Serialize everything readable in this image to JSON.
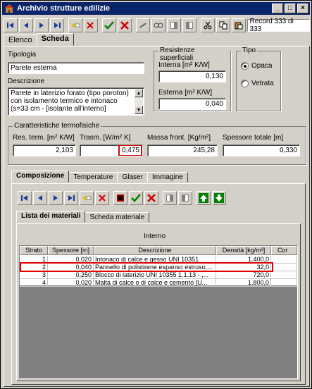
{
  "window": {
    "title": "Archivio strutture edilizie",
    "controls": [
      "_",
      "□",
      "×"
    ]
  },
  "toolbar": {
    "buttons": [
      "first",
      "prev",
      "next",
      "last",
      "insert",
      "delete",
      "confirm",
      "cancel",
      "tools",
      "search",
      "copy",
      "paste",
      "cut",
      "copy2",
      "print"
    ],
    "record": "Record 333 di 333"
  },
  "tabs": [
    "Elenco",
    "Scheda"
  ],
  "form": {
    "tipologia_label": "Tipologia",
    "tipologia_value": "Parete esterna",
    "descrizione_label": "Descrizione",
    "descrizione_value": "Parete in laterizio forato (tipo poroton) con isolamento termico e intonaco (s=33 cm - [isolante all'interno]"
  },
  "resistenze": {
    "title": "Resistenze superficiali",
    "interna_label": "Interna [m² K/W]",
    "interna_value": "0,130",
    "esterna_label": "Esterna  [m² K/W]",
    "esterna_value": "0,040"
  },
  "tipo": {
    "title": "Tipo",
    "opaca": "Opaca",
    "vetrata": "Vetrata",
    "selected": "Opaca"
  },
  "caratteristiche": {
    "title": "Caratteristiche termofisiche",
    "res_label": "Res. term. [m² K/W]",
    "res_value": "2,103",
    "trasm_label": "Trasm. [W/m² K]",
    "trasm_value": "0,475",
    "massa_label": "Massa front. [Kg/m²]",
    "massa_value": "245,28",
    "spessore_label": "Spessore totale [m]",
    "spessore_value": "0,330"
  },
  "subtabs": [
    "Composizione",
    "Temperature",
    "Glaser",
    "Immagine"
  ],
  "materiali_tabs": [
    "Lista dei materiali",
    "Scheda materiale"
  ],
  "grid": {
    "caption": "Interno",
    "headers": [
      "Strato",
      "Spessore [m]",
      "Descrizione",
      "Densità [kg/m³]",
      "Cor"
    ],
    "rows": [
      [
        "1",
        "0,020",
        "Intonaco di calce e gesso UNI 10351",
        "1.400,0"
      ],
      [
        "2",
        "0,040",
        "Pannello di polistirene espanso estruso,...",
        "32,0"
      ],
      [
        "3",
        "0,250",
        "Blocco di laterizio UNI 10355 1.1.13 - ,...",
        "720,0"
      ],
      [
        "4",
        "0,020",
        "Malta di calce o di calce e cemento [U...",
        "1.800,0"
      ]
    ]
  }
}
